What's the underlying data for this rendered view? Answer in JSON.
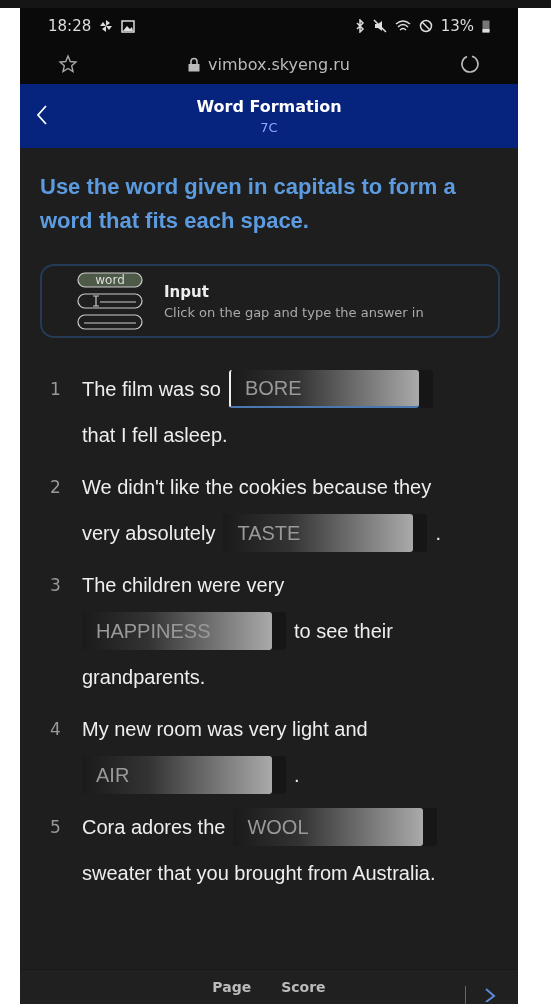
{
  "status_bar": {
    "time": "18:28",
    "battery": "13%"
  },
  "browser": {
    "url": "vimbox.skyeng.ru"
  },
  "header": {
    "title": "Word Formation",
    "subtitle": "7C"
  },
  "instruction": "Use the word given in capitals to form a word that fits each space.",
  "hint": {
    "icon_label": "word",
    "title": "Input",
    "text": "Click on the gap and type the answer in"
  },
  "items": [
    {
      "number": "1",
      "lines": [
        [
          {
            "kind": "text",
            "text": "The film was so"
          },
          {
            "kind": "gap",
            "placeholder": "BORE",
            "focused": true
          }
        ],
        [
          {
            "kind": "text",
            "text": "that I fell asleep."
          }
        ]
      ]
    },
    {
      "number": "2",
      "lines": [
        [
          {
            "kind": "text",
            "text": "We didn't like the cookies because they"
          }
        ],
        [
          {
            "kind": "text",
            "text": "very absolutely"
          },
          {
            "kind": "gap",
            "placeholder": "TASTE",
            "focused": false
          },
          {
            "kind": "text",
            "text": "."
          }
        ]
      ]
    },
    {
      "number": "3",
      "lines": [
        [
          {
            "kind": "text",
            "text": "The children were very"
          }
        ],
        [
          {
            "kind": "gap",
            "placeholder": "HAPPINESS",
            "focused": false
          },
          {
            "kind": "text",
            "text": "to see their"
          }
        ],
        [
          {
            "kind": "text",
            "text": "grandparents."
          }
        ]
      ]
    },
    {
      "number": "4",
      "lines": [
        [
          {
            "kind": "text",
            "text": "My new room was very light and"
          }
        ],
        [
          {
            "kind": "gap",
            "placeholder": "AIR",
            "focused": false
          },
          {
            "kind": "text",
            "text": "."
          }
        ]
      ]
    },
    {
      "number": "5",
      "lines": [
        [
          {
            "kind": "text",
            "text": "Cora adores the"
          },
          {
            "kind": "gap",
            "placeholder": "WOOL",
            "focused": false
          }
        ],
        [
          {
            "kind": "text",
            "text": "sweater that you brought from Australia."
          }
        ]
      ]
    }
  ],
  "footer": {
    "labels": [
      "Page",
      "Score"
    ]
  }
}
